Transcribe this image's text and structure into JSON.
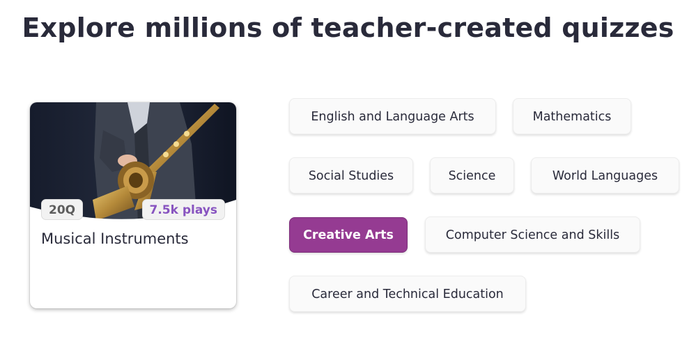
{
  "heading": "Explore millions of teacher-created quizzes",
  "quiz_card": {
    "title": "Musical Instruments",
    "question_count": "20Q",
    "plays": "7.5k plays",
    "image": "saxophone-photo"
  },
  "categories": [
    {
      "label": "English and Language Arts",
      "active": false
    },
    {
      "label": "Mathematics",
      "active": false
    },
    {
      "label": "Social Studies",
      "active": false
    },
    {
      "label": "Science",
      "active": false
    },
    {
      "label": "World Languages",
      "active": false
    },
    {
      "label": "Creative Arts",
      "active": true
    },
    {
      "label": "Computer Science and Skills",
      "active": false
    },
    {
      "label": "Career and Technical Education",
      "active": false
    }
  ],
  "colors": {
    "active_chip": "#953b92",
    "plays_text": "#8854c0",
    "heading_text": "#292a3a"
  }
}
